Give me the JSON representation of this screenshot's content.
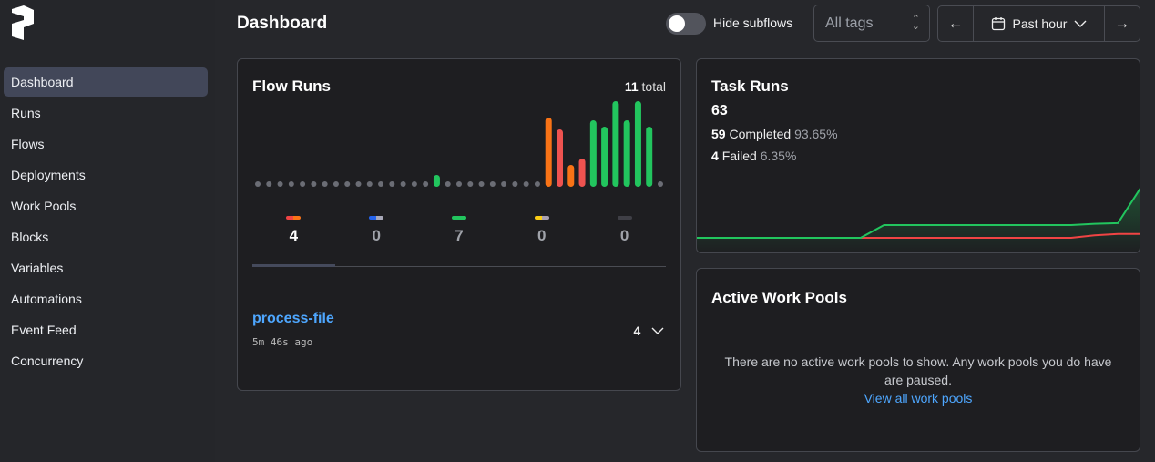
{
  "sidebar": {
    "items": [
      {
        "label": "Dashboard",
        "active": true
      },
      {
        "label": "Runs"
      },
      {
        "label": "Flows"
      },
      {
        "label": "Deployments"
      },
      {
        "label": "Work Pools"
      },
      {
        "label": "Blocks"
      },
      {
        "label": "Variables"
      },
      {
        "label": "Automations"
      },
      {
        "label": "Event Feed"
      },
      {
        "label": "Concurrency"
      }
    ]
  },
  "header": {
    "title": "Dashboard",
    "hide_subflows": "Hide subflows",
    "hide_subflows_on": false,
    "tags_placeholder": "All tags",
    "range_label": "Past hour"
  },
  "flow_runs": {
    "title": "Flow Runs",
    "total": "11",
    "total_label": "total",
    "states": [
      {
        "value": "4",
        "colors": [
          "#ef4444",
          "#f97316"
        ]
      },
      {
        "value": "0",
        "colors": [
          "#2563eb",
          "#a8a8b8"
        ]
      },
      {
        "value": "7",
        "colors": [
          "#22c55e"
        ]
      },
      {
        "value": "0",
        "colors": [
          "#facc15",
          "#a8a0b0"
        ]
      },
      {
        "value": "0",
        "colors": [
          "#3f3f46"
        ]
      }
    ],
    "bars": [
      0,
      0,
      0,
      0,
      0,
      0,
      0,
      0,
      0,
      0,
      0,
      0,
      0,
      0,
      0,
      0,
      {
        "v": 13,
        "c": "#22c55e"
      },
      0,
      0,
      0,
      0,
      0,
      0,
      0,
      0,
      0,
      {
        "v": 76,
        "c": "#f97316"
      },
      {
        "v": 63,
        "c": "#ef5350"
      },
      {
        "v": 24,
        "c": "#f97316"
      },
      {
        "v": 31,
        "c": "#ef5350"
      },
      {
        "v": 73,
        "c": "#22c55e"
      },
      {
        "v": 66,
        "c": "#22c55e"
      },
      {
        "v": 94,
        "c": "#22c55e"
      },
      {
        "v": 73,
        "c": "#22c55e"
      },
      {
        "v": 94,
        "c": "#22c55e"
      },
      {
        "v": 66,
        "c": "#22c55e"
      },
      0
    ],
    "flow": {
      "name": "process-file",
      "time": "5m 46s ago",
      "count": "4"
    }
  },
  "task_runs": {
    "title": "Task Runs",
    "total": "63",
    "completed": "59",
    "completed_label": "Completed",
    "completed_pct": "93.65%",
    "failed": "4",
    "failed_label": "Failed",
    "failed_pct": "6.35%",
    "completed_series": [
      0,
      0,
      0,
      0,
      0,
      0,
      0,
      0,
      1,
      1,
      1,
      1,
      1,
      1,
      1,
      1,
      1,
      1.1,
      1.15,
      4
    ],
    "failed_series": [
      0,
      0,
      0,
      0,
      0,
      0,
      0,
      0,
      0,
      0,
      0,
      0,
      0,
      0,
      0,
      0,
      0,
      0.2,
      0.3,
      0.3
    ]
  },
  "work_pools": {
    "title": "Active Work Pools",
    "empty": "There are no active work pools to show. Any work pools you do have are paused.",
    "link": "View all work pools"
  }
}
